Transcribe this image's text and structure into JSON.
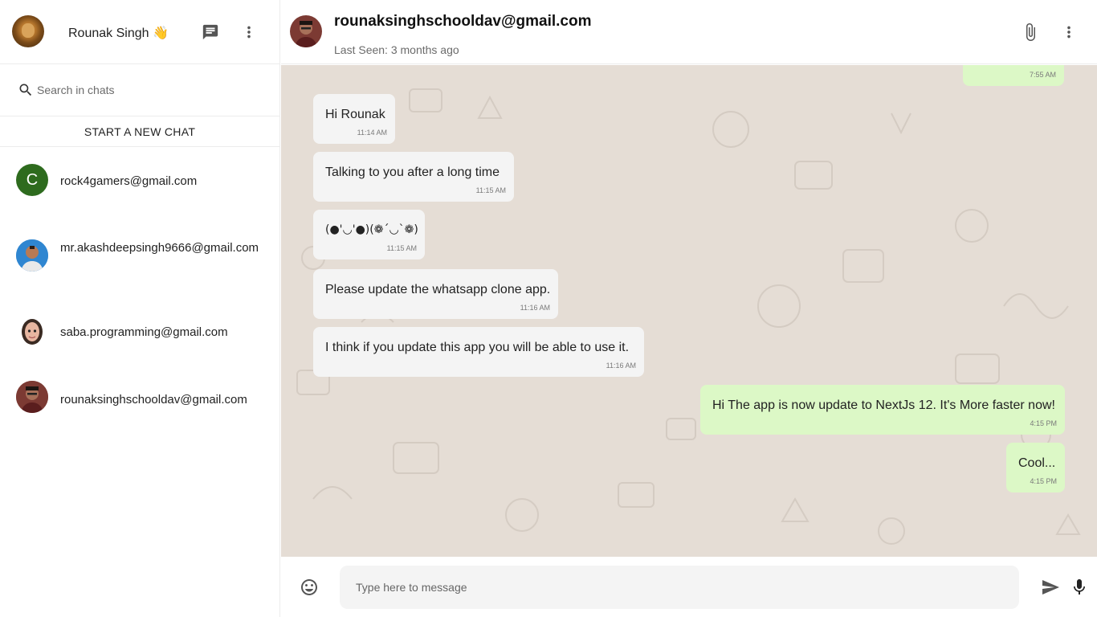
{
  "sidebar": {
    "user_name": "Rounak Singh 👋",
    "search": {
      "placeholder": "Search in chats"
    },
    "new_chat_label": "START A NEW CHAT",
    "chats": [
      {
        "email": "rock4gamers@gmail.com",
        "avatar_letter": "C"
      },
      {
        "email": "mr.akashdeepsingh9666@gmail.com"
      },
      {
        "email": "saba.programming@gmail.com"
      },
      {
        "email": "rounaksinghschooldav@gmail.com"
      }
    ]
  },
  "chat": {
    "contact_email": "rounaksinghschooldav@gmail.com",
    "last_seen": "Last Seen: 3 months ago",
    "messages": [
      {
        "direction": "out",
        "text": "",
        "time": "7:55 AM"
      },
      {
        "direction": "in",
        "text": "Hi Rounak",
        "time": "11:14 AM"
      },
      {
        "direction": "in",
        "text": "Talking to you after a long time",
        "time": "11:15 AM"
      },
      {
        "direction": "in",
        "text": "(●'◡'●)(❁´◡`❁)",
        "time": "11:15 AM"
      },
      {
        "direction": "in",
        "text": "Please update the whatsapp clone app.",
        "time": "11:16 AM"
      },
      {
        "direction": "in",
        "text": "I think if you update this app you will be able to use it.",
        "time": "11:16 AM"
      },
      {
        "direction": "out",
        "text": "Hi The app is now update to NextJs 12. It's More faster now!",
        "time": "4:15 PM"
      },
      {
        "direction": "out",
        "text": "Cool...",
        "time": "4:15 PM"
      }
    ],
    "input": {
      "placeholder": "Type here to message"
    }
  },
  "colors": {
    "incoming_bubble": "#f4f4f4",
    "outgoing_bubble": "#dcf8c6",
    "chat_background": "#e5ddd5",
    "avatar_green": "#2e6b1e"
  },
  "icons": [
    "chat-icon",
    "more-vert-icon",
    "search-icon",
    "attach-icon",
    "emoji-icon",
    "send-icon",
    "mic-icon"
  ]
}
